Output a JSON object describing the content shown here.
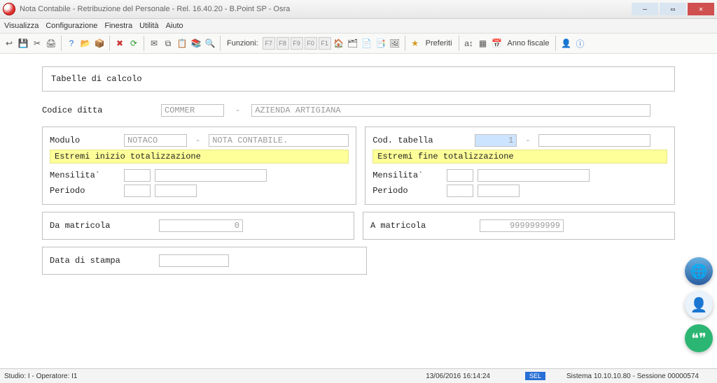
{
  "window": {
    "title": "Nota Contabile - Retribuzione del Personale - Rel. 16.40.20 - B.Point SP - Osra"
  },
  "menu": {
    "visualizza": "Visualizza",
    "configurazione": "Configurazione",
    "finestra": "Finestra",
    "utilita": "Utilità",
    "aiuto": "Aiuto"
  },
  "toolbar": {
    "funzioni_label": "Funzioni:",
    "preferiti_label": "Preferiti",
    "anno_fiscale_label": "Anno fiscale",
    "fkeys": [
      "F7",
      "F8",
      "F9",
      "F0",
      "F1"
    ]
  },
  "form": {
    "section_title": "Tabelle di calcolo",
    "codice_ditta_label": "Codice ditta",
    "codice_ditta_code": "COMMER",
    "codice_ditta_desc": "AZIENDA ARTIGIANA",
    "modulo_label": "Modulo",
    "modulo_code": "NOTACO",
    "modulo_desc": "NOTA CONTABILE.",
    "cod_tabella_label": "Cod. tabella",
    "cod_tabella_value": "1",
    "inizio_banner": "Estremi inizio totalizzazione",
    "fine_banner": "Estremi fine totalizzazione",
    "mensilita_label": "Mensilita`",
    "periodo_label": "Periodo",
    "da_matricola_label": "Da matricola",
    "da_matricola_value": "0",
    "a_matricola_label": "A matricola",
    "a_matricola_value": "9999999999",
    "data_di_stampa_label": "Data di stampa"
  },
  "status": {
    "studio": "Studio: I - Operatore: I1",
    "datetime": "13/06/2016   16:14:24",
    "sel_badge": "SEL",
    "sistema": "Sistema 10.10.10.80 - Sessione 00000574"
  }
}
